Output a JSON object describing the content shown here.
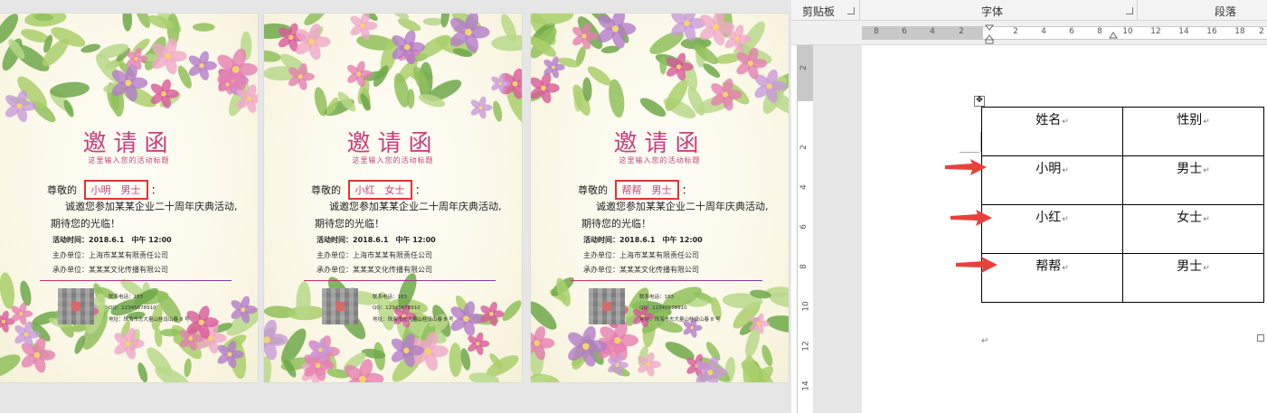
{
  "cards": [
    {
      "title": "邀请函",
      "subtitle": "这里输入您的活动标题",
      "greeting": "尊敬的",
      "name": "小明",
      "gender": "男士",
      "greeting_end": "：",
      "body_line1": "诚邀您参加某某企业二十周年庆典活动,",
      "body_line2": "期待您的光临！",
      "time_label": "活动时间：",
      "time_value": "2018.6.1　中午 12:00",
      "host_label": "主办单位：",
      "host_value": "上海市某某有限责任公司",
      "organizer_label": "承办单位：",
      "organizer_value": "某某某文化传播有限公司",
      "phone": "联系电话：183 ",
      "qq": "QQ：12345678910",
      "address": "地址：珠海市志大量山桂设山春 8 号"
    },
    {
      "title": "邀请函",
      "subtitle": "这里输入您的活动标题",
      "greeting": "尊敬的",
      "name": "小红",
      "gender": "女士",
      "greeting_end": "：",
      "body_line1": "诚邀您参加某某企业二十周年庆典活动,",
      "body_line2": "期待您的光临！",
      "time_label": "活动时间：",
      "time_value": "2018.6.1　中午 12:00",
      "host_label": "主办单位：",
      "host_value": "上海市某某有限责任公司",
      "organizer_label": "承办单位：",
      "organizer_value": "某某某文化传播有限公司",
      "phone": "联系电话：183 ",
      "qq": "QQ：12345678910",
      "address": "地址：珠海市志大量山桂设山春 8 号"
    },
    {
      "title": "邀请函",
      "subtitle": "这里输入您的活动标题",
      "greeting": "尊敬的",
      "name": "帮帮",
      "gender": "男士",
      "greeting_end": "：",
      "body_line1": "诚邀您参加某某企业二十周年庆典活动,",
      "body_line2": "期待您的光临！",
      "time_label": "活动时间：",
      "time_value": "2018.6.1　中午 12:00",
      "host_label": "主办单位：",
      "host_value": "上海市某某有限责任公司",
      "organizer_label": "承办单位：",
      "organizer_value": "某某某文化传播有限公司",
      "phone": "联系电话：183 ",
      "qq": "QQ：12345678910",
      "address": "地址：珠海市志大量山桂设山春 8 号"
    }
  ],
  "ribbon": {
    "clipboard": "剪贴板",
    "font": "字体",
    "paragraph": "段落"
  },
  "ruler": {
    "tab_button": "L",
    "h_numbers": [
      "8",
      "6",
      "4",
      "2",
      "2",
      "4",
      "6",
      "8",
      "10",
      "12",
      "14",
      "16",
      "18",
      "2"
    ],
    "v_numbers": [
      "2",
      "2",
      "4",
      "6",
      "8",
      "10",
      "12",
      "14"
    ]
  },
  "table": {
    "headers": [
      "姓名",
      "性别"
    ],
    "rows": [
      [
        "小明",
        "男士"
      ],
      [
        "小红",
        "女士"
      ],
      [
        "帮帮",
        "男士"
      ]
    ]
  },
  "marks": {
    "paragraph": "↵",
    "move": "✥"
  },
  "colors": {
    "title_pink": "#c8407e",
    "highlight_red": "#e03434",
    "arrow_red": "#e8413b"
  }
}
